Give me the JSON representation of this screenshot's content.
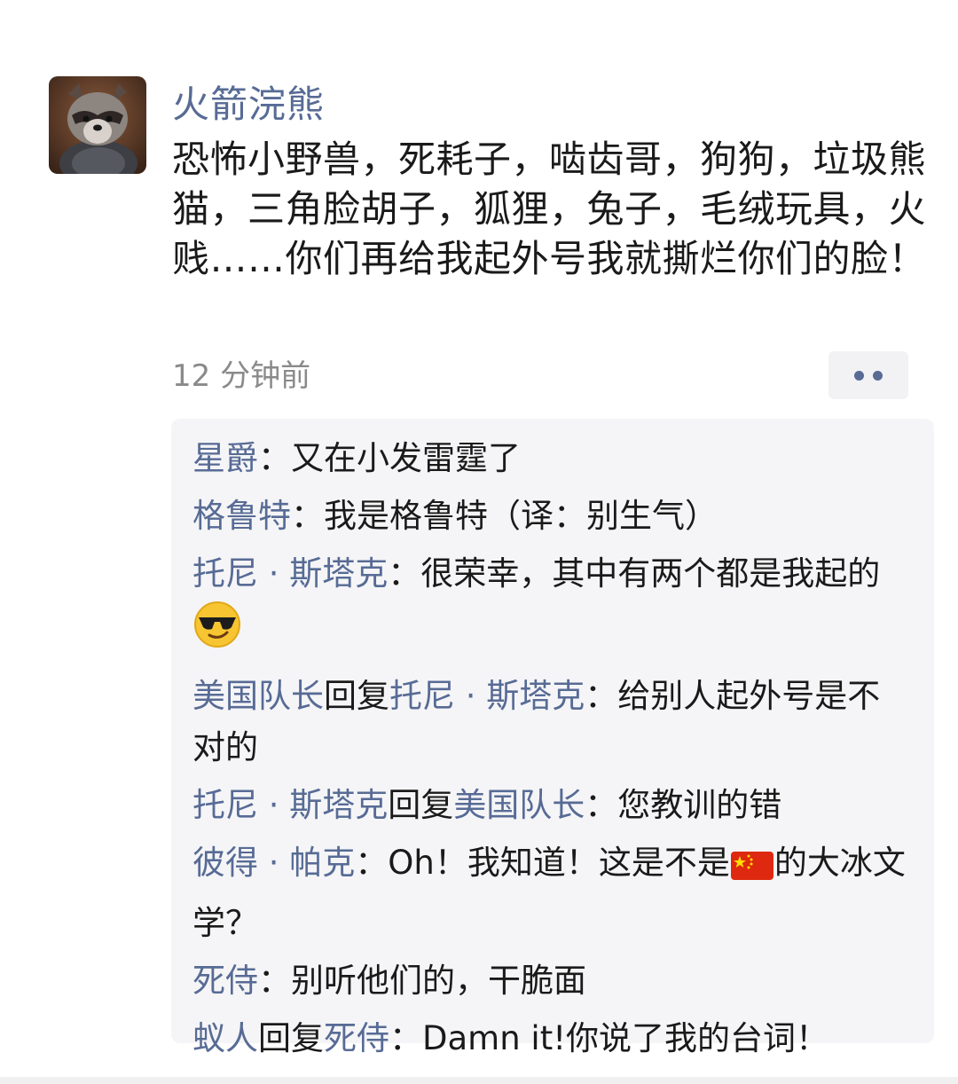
{
  "post": {
    "author": "火箭浣熊",
    "text": "恐怖小野兽，死耗子，啮齿哥，狗狗，垃圾熊猫，三角脸胡子，狐狸，兔子，毛绒玩具，火贱……你们再给我起外号我就撕烂你们的脸！",
    "time": "12 分钟前"
  },
  "comments": [
    {
      "author": "星爵",
      "reply_word": "",
      "reply_to": "",
      "colon": "：",
      "text": "又在小发雷霆了"
    },
    {
      "author": "格鲁特",
      "reply_word": "",
      "reply_to": "",
      "colon": "：",
      "text": "我是格鲁特（译：别生气）"
    },
    {
      "author": "托尼 · 斯塔克",
      "reply_word": "",
      "reply_to": "",
      "colon": "：",
      "text": "很荣幸，其中有两个都是我起的",
      "emoji": "sunglasses-emoji"
    },
    {
      "author": "美国队长",
      "reply_word": "回复",
      "reply_to": "托尼 · 斯塔克",
      "colon": "：",
      "text": "给别人起外号是不对的"
    },
    {
      "author": "托尼 · 斯塔克",
      "reply_word": "回复",
      "reply_to": "美国队长",
      "colon": "：",
      "text": "您教训的错"
    },
    {
      "author": "彼得 · 帕克",
      "reply_word": "",
      "reply_to": "",
      "colon": "：",
      "text": "Oh！我知道！这是不是",
      "flag": "china-flag-emoji",
      "text_after": "的大冰文学？"
    },
    {
      "author": "死侍",
      "reply_word": "",
      "reply_to": "",
      "colon": "：",
      "text": "别听他们的，干脆面"
    },
    {
      "author": "蚁人",
      "reply_word": "回复",
      "reply_to": "死侍",
      "colon": "：",
      "text": "Damn it!你说了我的台词！"
    }
  ],
  "colors": {
    "name_link": "#576b95",
    "body_text": "#1a1a1a",
    "time_text": "#8a8a8a",
    "comment_bg": "#f5f5f7"
  }
}
